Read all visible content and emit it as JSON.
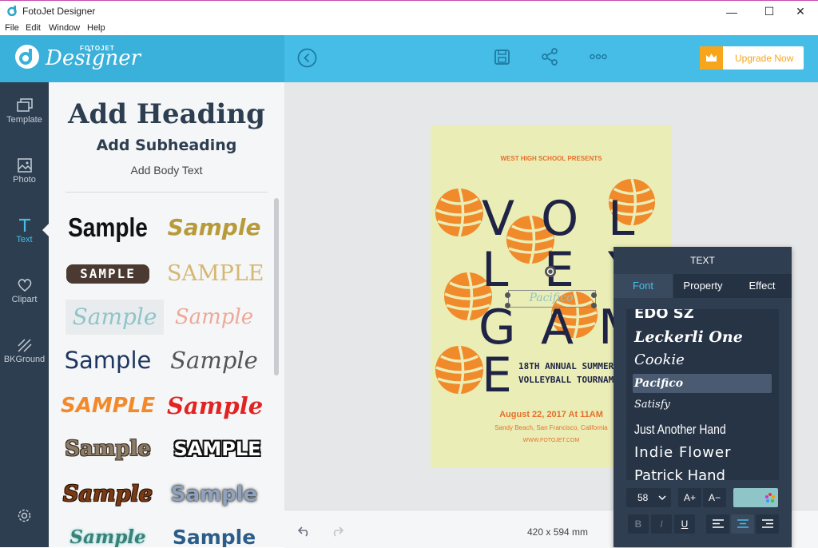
{
  "window": {
    "title": "FotoJet Designer",
    "minimize": "—",
    "maximize": "☐",
    "close": "✕"
  },
  "menu": [
    "File",
    "Edit",
    "Window",
    "Help"
  ],
  "logo": {
    "brand": "FOTOJET",
    "name": "Designer"
  },
  "toolbar": {
    "upgrade_label": "Upgrade Now"
  },
  "nav": [
    {
      "label": "Template"
    },
    {
      "label": "Photo"
    },
    {
      "label": "Text"
    },
    {
      "label": "Clipart"
    },
    {
      "label": "BKGround"
    }
  ],
  "panel": {
    "heading": "Add Heading",
    "subheading": "Add Subheading",
    "body": "Add Body Text",
    "samples": [
      {
        "text": "Sample"
      },
      {
        "text": "Sample"
      },
      {
        "text": "SAMPLE"
      },
      {
        "text": "SAMPLE"
      },
      {
        "text": "Sample"
      },
      {
        "text": "Sample"
      },
      {
        "text": "Sample"
      },
      {
        "text": "Sample"
      },
      {
        "text": "SAMPLE"
      },
      {
        "text": "Sample"
      },
      {
        "text": "Sample"
      },
      {
        "text": "SAMPLE"
      },
      {
        "text": "Sample"
      },
      {
        "text": "Sample"
      },
      {
        "text": "Sample"
      },
      {
        "text": "Sample"
      }
    ]
  },
  "poster": {
    "presents": "WEST HIGH SCHOOL PRESENTS",
    "letters": [
      "V",
      "O",
      "L",
      "L",
      "E",
      "Y",
      "G",
      "A",
      "M",
      "E"
    ],
    "announce_line1": "18TH ANNUAL SUMMER",
    "announce_line2": "VOLLEYBALL TOURNAM",
    "date": "August 22, 2017 At 11AM",
    "location": "Sandy Beach, San Francisco, California",
    "website": "WWW.FOTOJET.COM",
    "selected_text": "Pacifico"
  },
  "canvas": {
    "size": "420 x 594 mm"
  },
  "text_panel": {
    "title": "TEXT",
    "tabs": [
      "Font",
      "Property",
      "Effect"
    ],
    "fonts": [
      "EDO SZ",
      "Leckerli One",
      "Cookie",
      "Pacifico",
      "Satisfy",
      "Just Another Hand",
      "Indie Flower",
      "Patrick Hand"
    ],
    "selected_font": "Pacifico",
    "font_size": "58",
    "increase": "A+",
    "decrease": "A−",
    "bold": "B",
    "italic": "I",
    "underline": "U",
    "text_color": "#8fc4c8"
  },
  "colors": {
    "accent": "#46bde6",
    "nav_bg": "#2d3e50",
    "upgrade": "#f7a61b",
    "poster_bg": "#eaeeb6",
    "ball_orange": "#f08a2b"
  }
}
